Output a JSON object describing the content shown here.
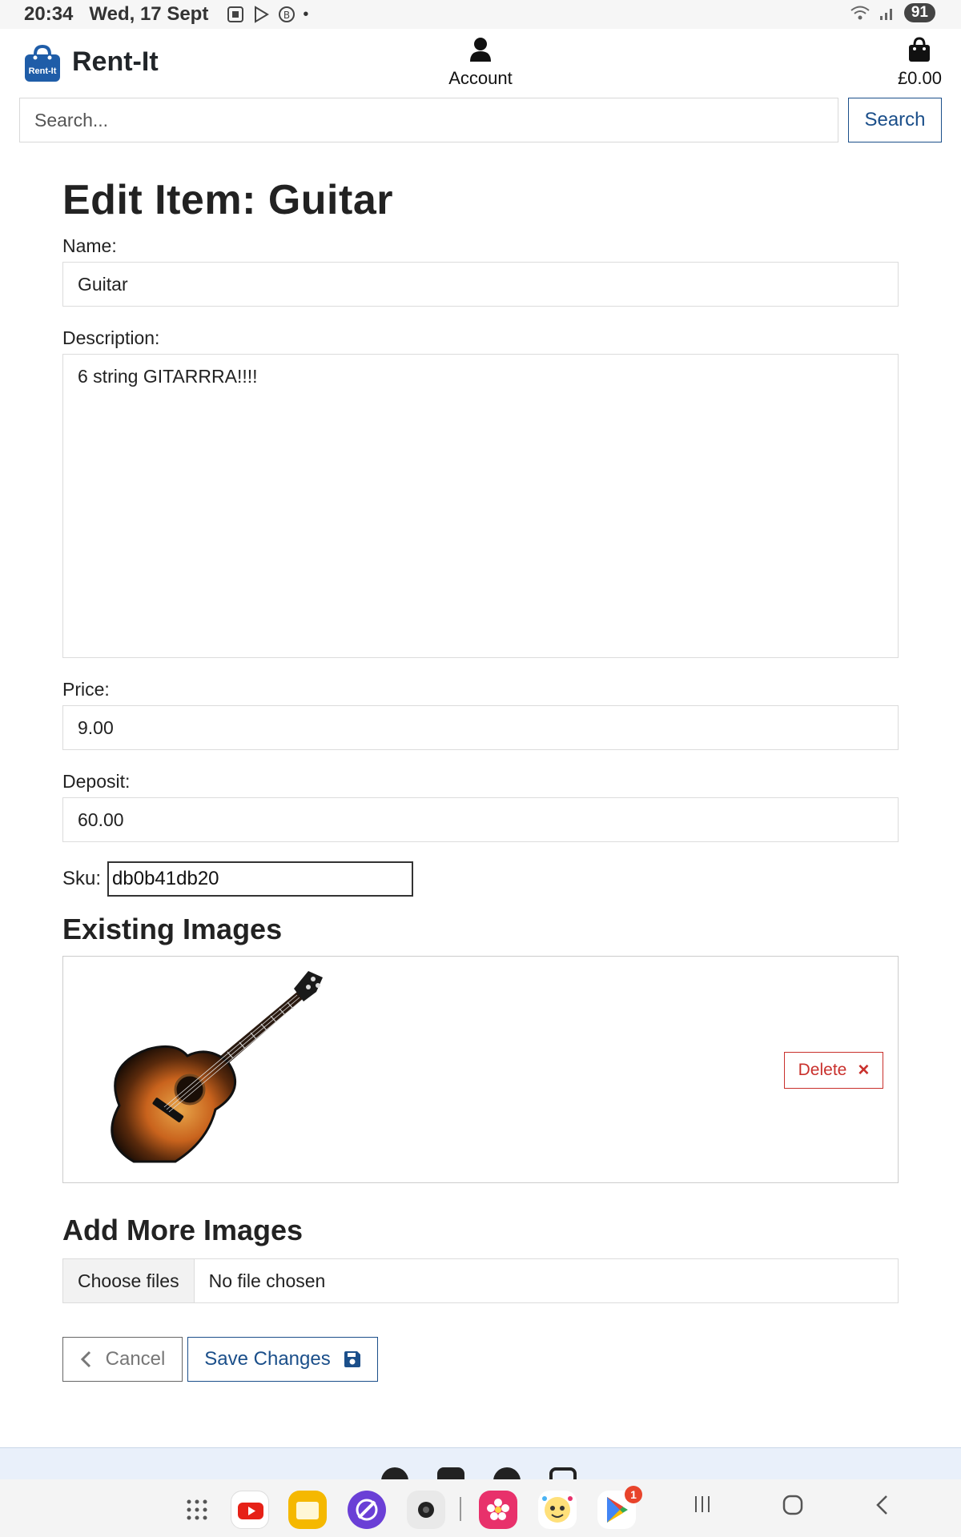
{
  "status_bar": {
    "time": "20:34",
    "date": "Wed, 17 Sept",
    "battery": "91"
  },
  "header": {
    "brand": "Rent-It",
    "logo_text": "Rent-It",
    "account_label": "Account",
    "cart_total": "£0.00"
  },
  "search": {
    "placeholder": "Search...",
    "button_label": "Search"
  },
  "form": {
    "title": "Edit Item: Guitar",
    "name_label": "Name:",
    "name_value": "Guitar",
    "description_label": "Description:",
    "description_value": "6 string GITARRRA!!!!",
    "price_label": "Price:",
    "price_value": "9.00",
    "deposit_label": "Deposit:",
    "deposit_value": "60.00",
    "sku_label": "Sku:",
    "sku_value": "db0b41db20"
  },
  "existing_images": {
    "heading": "Existing Images",
    "delete_label": "Delete",
    "delete_icon": "×"
  },
  "add_images": {
    "heading": "Add More Images",
    "choose_label": "Choose files",
    "status": "No file chosen"
  },
  "actions": {
    "cancel_label": "Cancel",
    "save_label": "Save Changes"
  },
  "notifications": {
    "play_store_badge": "1"
  },
  "colors": {
    "primary": "#1b4f8a",
    "danger": "#c9302c",
    "logo_bg": "#1f5da8"
  }
}
